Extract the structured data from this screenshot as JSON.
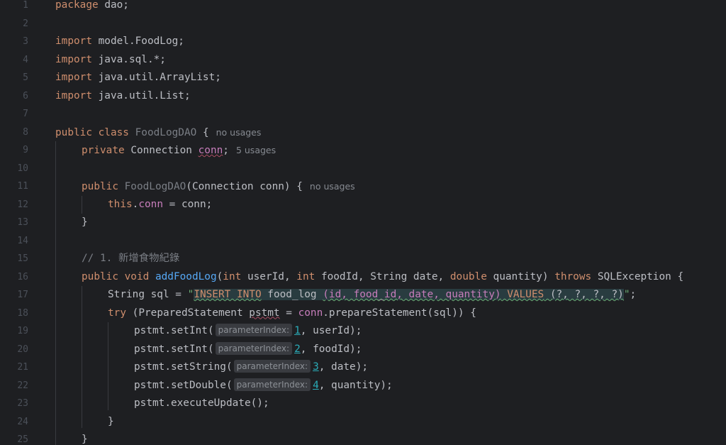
{
  "colors": {
    "background": "#1e1f22",
    "keyword": "#cf8e6d",
    "string": "#6aab73",
    "field": "#c77dbb",
    "method": "#56a8f5",
    "number": "#2aacb8",
    "comment": "#7a7e85",
    "line_number": "#4b5059"
  },
  "line_numbers": [
    "1",
    "2",
    "3",
    "4",
    "5",
    "6",
    "7",
    "8",
    "9",
    "10",
    "11",
    "12",
    "13",
    "14",
    "15",
    "16",
    "17",
    "18",
    "19",
    "20",
    "21",
    "22",
    "23",
    "24",
    "25"
  ],
  "code": {
    "l1": {
      "kw": "package",
      "rest": " dao;"
    },
    "l3": {
      "kw": "import",
      "rest": " model.FoodLog;"
    },
    "l4": {
      "kw": "import",
      "rest": " java.sql.*;"
    },
    "l5": {
      "kw": "import",
      "rest": " java.util.ArrayList;"
    },
    "l6": {
      "kw": "import",
      "rest": " java.util.List;"
    },
    "l8": {
      "kw": "public class",
      "name": " FoodLogDAO",
      "rest": " {",
      "usage": "no usages"
    },
    "l9": {
      "kw": "private",
      "type": " Connection ",
      "field": "conn",
      "semi": ";",
      "usage": "5 usages"
    },
    "l11": {
      "kw": "public",
      "name": " FoodLogDAO",
      "rest": "(Connection conn) {",
      "usage": "no usages"
    },
    "l12": {
      "kw": "this",
      "dot": ".",
      "field": "conn",
      "rest": " = conn;"
    },
    "l13": {
      "text": "}"
    },
    "l15": {
      "comment": "// 1. 新增食物紀錄"
    },
    "l16": {
      "kw1": "public void",
      "method": " addFoodLog",
      "p1": "(",
      "kw2": "int",
      "p2": " userId, ",
      "kw3": "int",
      "p3": " foodId, String date, ",
      "kw4": "double",
      "p4": " quantity) ",
      "kw5": "throws",
      "p5": " SQLException {"
    },
    "l17": {
      "pre": "String sql = ",
      "quote_open": "\"",
      "sql_insert": "INSERT INTO",
      "sql_table": " food_log ",
      "sql_cols": "(id, food_id, date, quantity)",
      "sql_values": " VALUES",
      "sql_params": " (?, ?, ?, ?)",
      "quote_close": "\"",
      "end": ";"
    },
    "l18": {
      "kw": "try",
      "p1": " (PreparedStatement ",
      "var": "pstmt",
      "p2": " = ",
      "field": "conn",
      "p3": ".prepareStatement(sql)) {"
    },
    "l19": {
      "pre": "pstmt.setInt(",
      "hint": "parameterIndex:",
      "num": "1",
      "rest": ", userId);"
    },
    "l20": {
      "pre": "pstmt.setInt(",
      "hint": "parameterIndex:",
      "num": "2",
      "rest": ", foodId);"
    },
    "l21": {
      "pre": "pstmt.setString(",
      "hint": "parameterIndex:",
      "num": "3",
      "rest": ", date);"
    },
    "l22": {
      "pre": "pstmt.setDouble(",
      "hint": "parameterIndex:",
      "num": "4",
      "rest": ", quantity);"
    },
    "l23": {
      "text": "pstmt.executeUpdate();"
    },
    "l24": {
      "text": "}"
    },
    "l25": {
      "text": "}"
    }
  }
}
